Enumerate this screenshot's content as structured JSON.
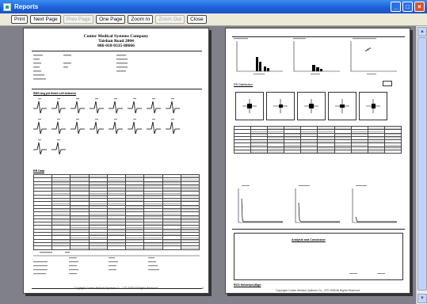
{
  "window": {
    "title": "Reports"
  },
  "toolbar": {
    "buttons": [
      {
        "label": "Print",
        "enabled": true
      },
      {
        "label": "Next Page",
        "enabled": true
      },
      {
        "label": "Prev Page",
        "enabled": false
      },
      {
        "label": "One Page",
        "enabled": true
      },
      {
        "label": "Zoom In",
        "enabled": true
      },
      {
        "label": "Zoom Out",
        "enabled": false
      },
      {
        "label": "Close",
        "enabled": true
      }
    ]
  },
  "left_page": {
    "company": [
      "Contec Medical Systems Company",
      "Taishan Road 2004",
      "086-018-0335-88666"
    ],
    "sections": {
      "waves": "SMS Avg ptt Heart Left between",
      "data": "RR Data"
    },
    "footer": "Copyright Contec Medical Systems Co., LTD 2008 All Rights Reserved"
  },
  "right_page": {
    "sections": {
      "distribution": "RR Distribution",
      "analysis": "Analysis and Conclusion",
      "signature": "RCS Holder(on)Sign"
    },
    "footer": "Copyright Contec Medical Systems Co., LTD 2008 All Rights Reserved"
  }
}
